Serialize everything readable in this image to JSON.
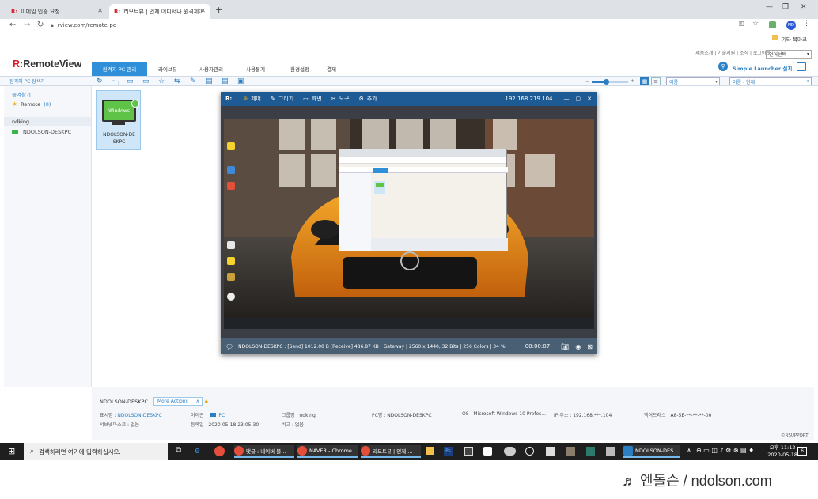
{
  "browser": {
    "tabs": [
      {
        "title": "이메일 인증 요청"
      },
      {
        "title": "리모트뷰 | 언제 어디서나 원격제어"
      }
    ],
    "new_tab": "+",
    "url": "rview.com/remote-pc",
    "bookmark_folder": "기타 북마크",
    "profile_initials": "ND"
  },
  "app": {
    "logo_prefix": "R:",
    "logo_text": "RemoteView",
    "nav": [
      "원격지 PC 관리",
      "라이브뷰",
      "사용자관리",
      "사용통계",
      "환경설정",
      "결제"
    ],
    "top_links": "제품소개 | 기술지원 | 소식 | 로그아웃",
    "language": "언어선택",
    "launcher_label": "Simple Launcher 설치",
    "sort_select": "이름",
    "search_scope": "이름 - 현재"
  },
  "sidebar": {
    "search_label": "원격지 PC 탐색기",
    "favorites_title": "즐겨찾기",
    "favorites_item": "Remote",
    "favorites_count": "(0)",
    "group_title": "ndking",
    "group_item": "NDOLSON-DESKPC"
  },
  "pc_card": {
    "os_label": "Windows",
    "name": "NDOLSON-DESKPC"
  },
  "remote_window": {
    "logo": "R:",
    "menu": [
      "제어",
      "그리기",
      "화면",
      "도구",
      "추가"
    ],
    "ip": "192.168.219.104",
    "status": "NDOLSON-DESKPC : [Send] 1012.00 B  [Receive] 486.87 KB | Gateway | 2560 x 1440, 32 Bits | 256 Colors | 34 %",
    "timer": "00:00:07"
  },
  "details": {
    "pc_name": "NDOLSON-DESKPC",
    "more_actions": "More Actions",
    "display_name_label": "표시명 :",
    "display_name_value": "NDOLSON-DESKPC",
    "icon_label": "아이콘 :",
    "icon_value": "PC",
    "group_label": "그룹명 :",
    "group_value": "ndking",
    "pc_name_label": "PC명 :",
    "pc_name_value": "NDOLSON-DESKPC",
    "os_label": "OS :",
    "os_value": "Microsoft Windows 10 Profes...",
    "ip_label": "IP 주소 :",
    "ip_value": "192.168.***.104",
    "mac_label": "맥어드레스 :",
    "mac_value": "A8-5E-**-**-**-00",
    "servermask_label": "서브넷마스크 :",
    "servermask_value": "없음",
    "registered_label": "등록일 :",
    "registered_value": "2020-05-18 23:05:30",
    "note_label": "비고 :",
    "note_value": "없음",
    "copyright": "©RSUPPORT"
  },
  "taskbar": {
    "search_placeholder": "검색하려면 여기에 입력하십시오.",
    "apps": [
      {
        "label": "댓글 : 네이버 블..."
      },
      {
        "label": "NAVER - Chrome"
      },
      {
        "label": "리모트뷰 | 언제 ..."
      },
      {
        "label": "NDOLSON-DES..."
      }
    ],
    "time": "오후 11:12",
    "date": "2020-05-18",
    "notif_count": "6"
  },
  "watermark": "♬ 엔돌슨 / ndolson.com"
}
